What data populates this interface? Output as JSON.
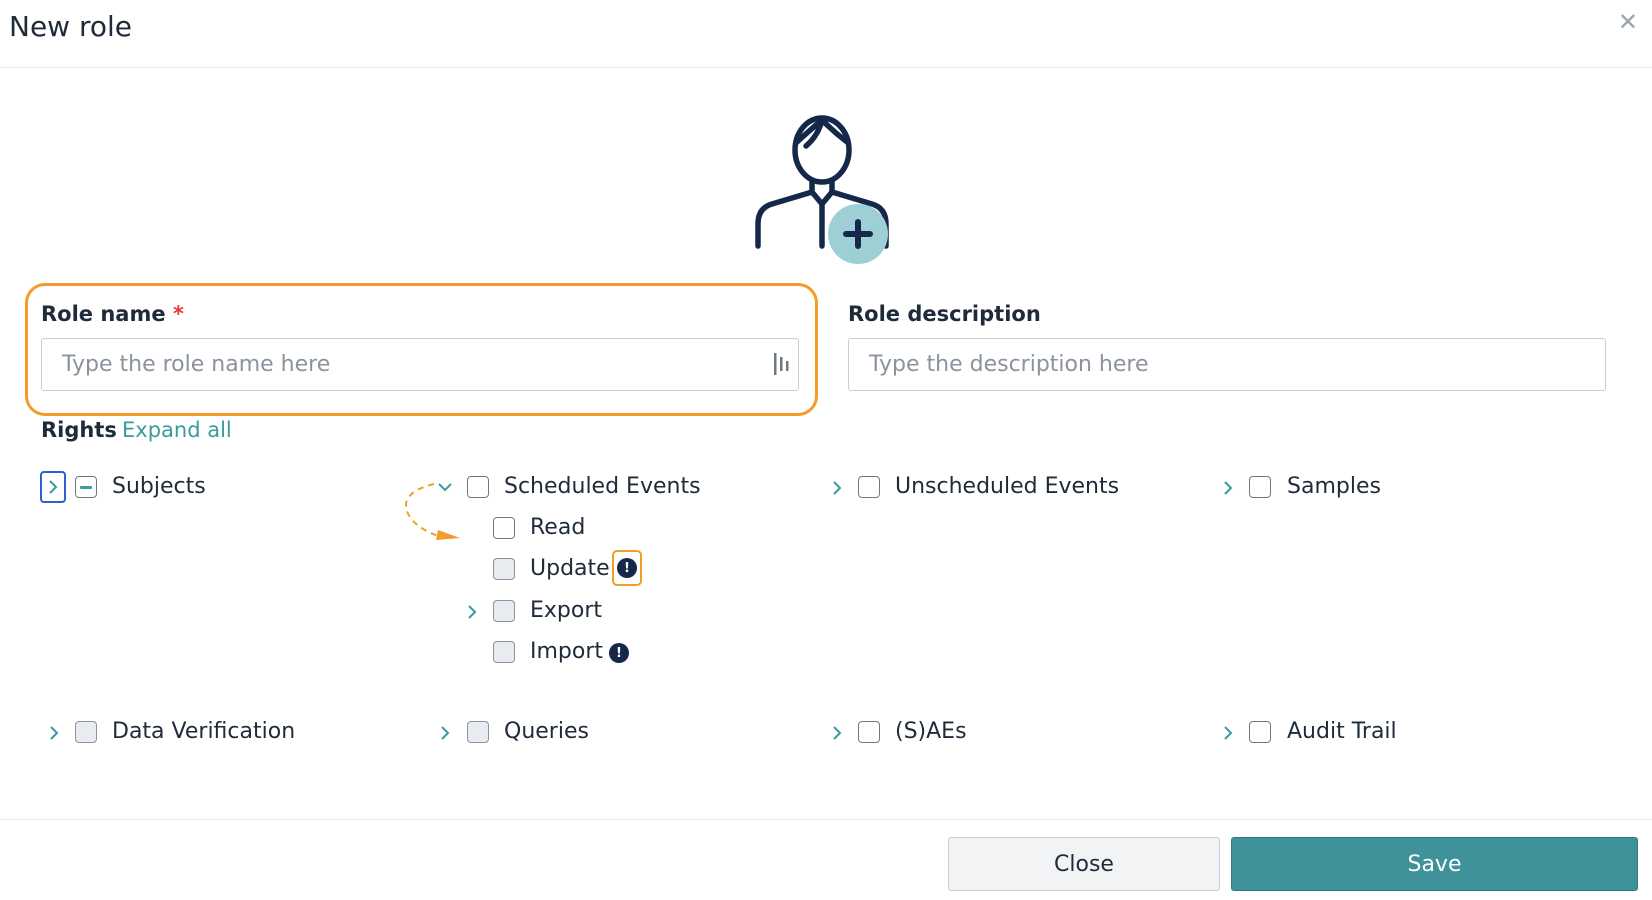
{
  "dialog": {
    "title": "New role"
  },
  "icons": {
    "close": "close-icon",
    "avatar": "user-add-icon",
    "drag": "drag-handle-icon",
    "warning": "exclamation-icon"
  },
  "colors": {
    "accent": "#3f9299",
    "highlight": "#f39c2b",
    "required": "#e03a3a",
    "focus": "#2f5fd0"
  },
  "form": {
    "role_name": {
      "label": "Role name",
      "required_mark": "*",
      "placeholder": "Type the role name here",
      "value": ""
    },
    "role_description": {
      "label": "Role description",
      "placeholder": "Type the description here",
      "value": ""
    }
  },
  "rights": {
    "label": "Rights",
    "expand_all": "Expand all",
    "subjects": "Subjects",
    "scheduled_events": {
      "label": "Scheduled Events",
      "children": [
        "Read",
        "Update",
        "Export",
        "Import"
      ]
    },
    "unscheduled_events": "Unscheduled Events",
    "samples": "Samples",
    "data_verification": "Data Verification",
    "queries": "Queries",
    "saes": "(S)AEs",
    "audit_trail": "Audit Trail"
  },
  "footer": {
    "close_label": "Close",
    "save_label": "Save"
  }
}
